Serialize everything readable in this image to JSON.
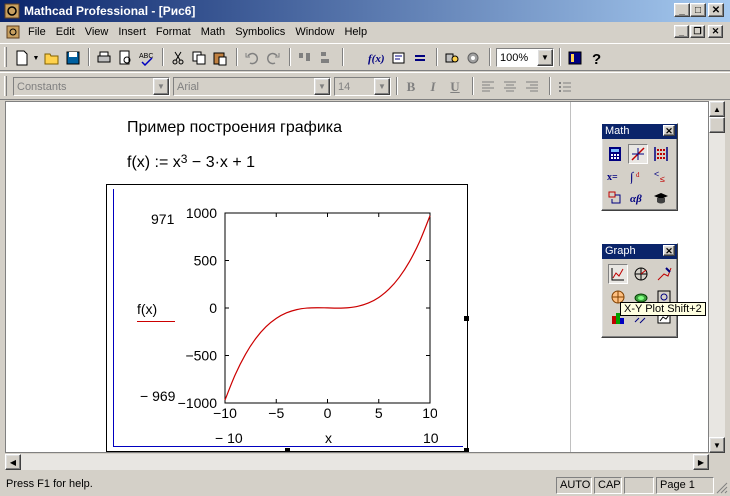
{
  "window": {
    "title": "Mathcad Professional - [Рис6]"
  },
  "menu": [
    "File",
    "Edit",
    "View",
    "Insert",
    "Format",
    "Math",
    "Symbolics",
    "Window",
    "Help"
  ],
  "toolbar": {
    "zoom": "100%"
  },
  "format_bar": {
    "style": "Constants",
    "font": "Arial",
    "size": "14",
    "bold": "B",
    "italic": "I",
    "underline": "U"
  },
  "worksheet": {
    "heading": "Пример построения графика",
    "formula_lhs": "f(x) := x",
    "formula_exp": "3",
    "formula_rhs": " − 3·x + 1"
  },
  "plot": {
    "y_max_label": "971",
    "y_min_label": "− 969",
    "x_min_label": "− 10",
    "x_max_label": "10",
    "y_axis_name": "f(x)",
    "x_axis_name": "x"
  },
  "chart_data": {
    "type": "line",
    "title": "",
    "xlabel": "x",
    "ylabel": "f(x)",
    "xlim": [
      -10,
      10
    ],
    "ylim": [
      -1000,
      1000
    ],
    "x_ticks": [
      "−10",
      "−5",
      "0",
      "5",
      "10"
    ],
    "y_ticks": [
      "1000",
      "500",
      "0",
      "−500",
      "−1000"
    ],
    "grid": false,
    "series": [
      {
        "color": "#cc0000",
        "x": [
          -10,
          -9,
          -8,
          -7,
          -6,
          -5,
          -4,
          -3,
          -2,
          -1,
          0,
          1,
          2,
          3,
          4,
          5,
          6,
          7,
          8,
          9,
          10
        ],
        "values": [
          -969,
          -701,
          -487,
          -321,
          -197,
          -109,
          -51,
          -17,
          -1,
          3,
          1,
          -1,
          3,
          19,
          53,
          111,
          199,
          323,
          489,
          703,
          971
        ]
      }
    ]
  },
  "palettes": {
    "math": {
      "title": "Math"
    },
    "graph": {
      "title": "Graph",
      "tooltip": "X-Y Plot Shift+2"
    }
  },
  "status": {
    "help": "Press F1 for help.",
    "auto": "AUTO",
    "cap": "CAP",
    "page": "Page 1"
  }
}
